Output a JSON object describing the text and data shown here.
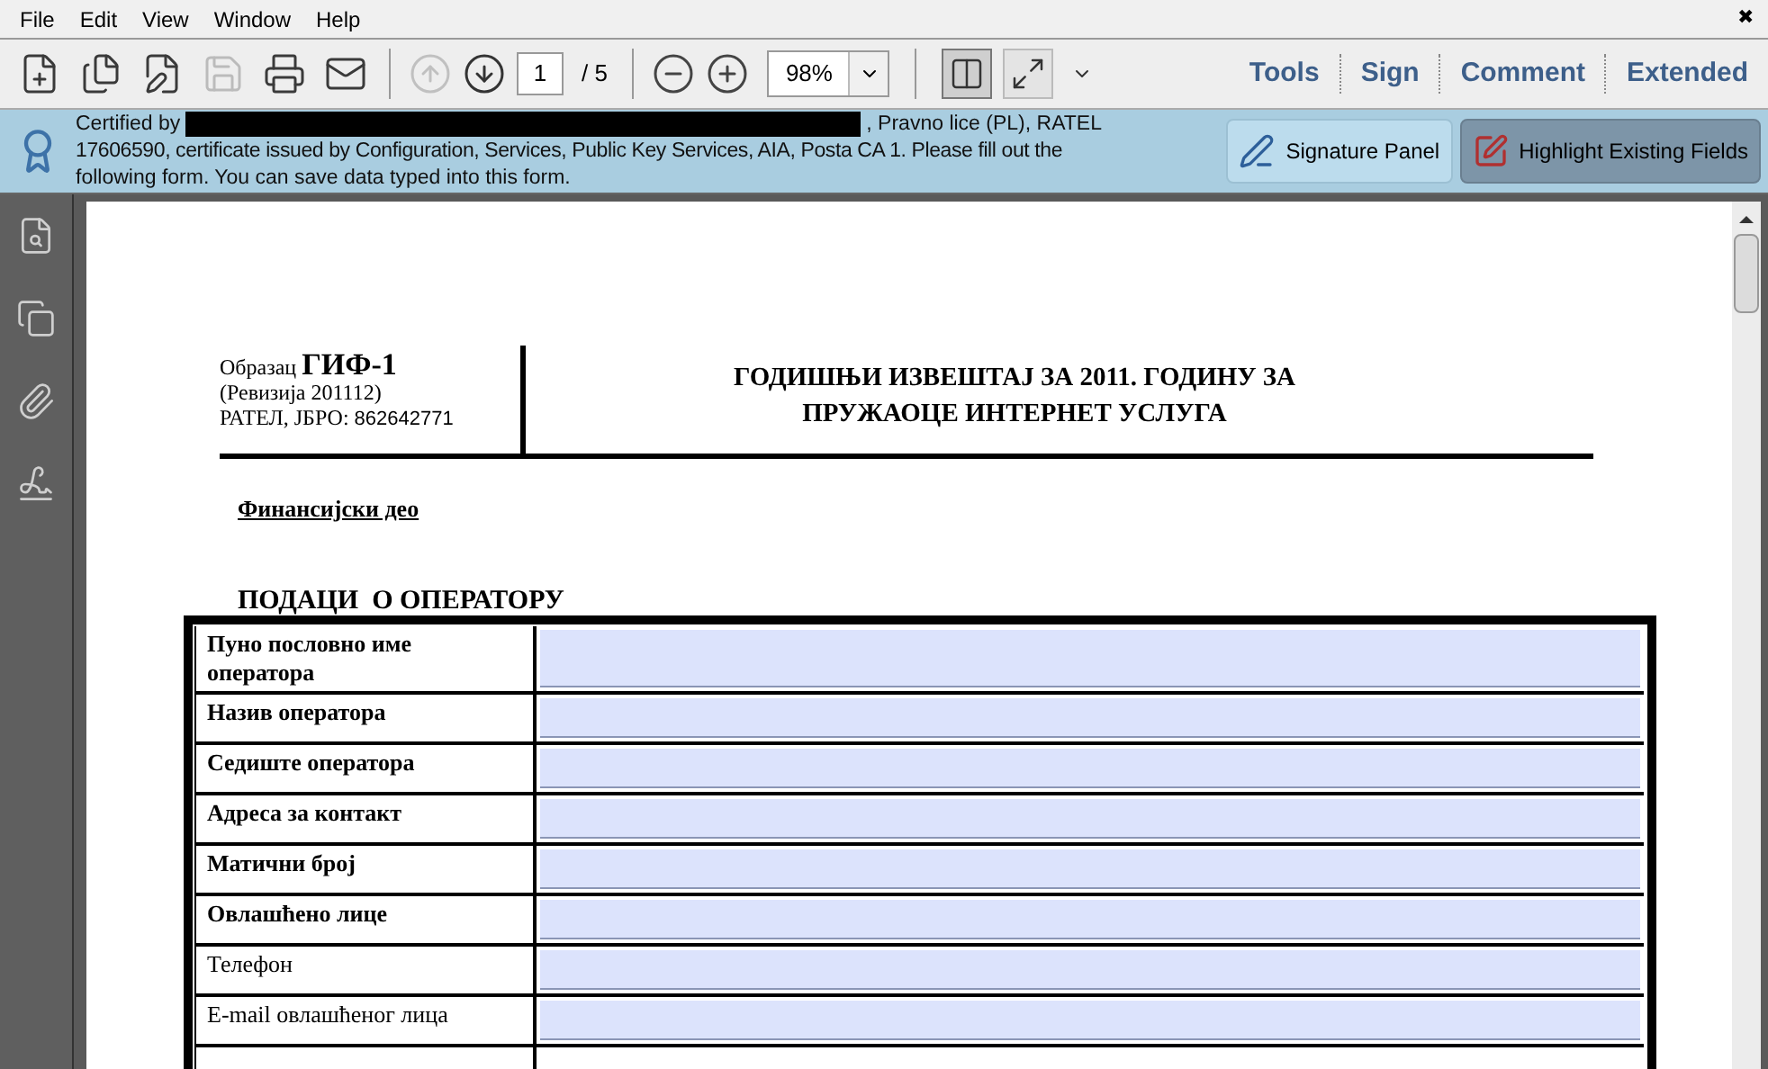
{
  "menu": [
    "File",
    "Edit",
    "View",
    "Window",
    "Help"
  ],
  "close_glyph": "✖",
  "toolbar": {
    "left_icons": [
      {
        "kind": "create",
        "disabled": false
      },
      {
        "kind": "combine",
        "disabled": false
      },
      {
        "kind": "edit",
        "disabled": false
      },
      {
        "kind": "save",
        "disabled": true
      },
      {
        "kind": "print",
        "disabled": false
      },
      {
        "kind": "email",
        "disabled": false
      }
    ],
    "nav_icons": [
      {
        "kind": "prev",
        "disabled": true
      },
      {
        "kind": "next",
        "disabled": false
      }
    ],
    "page_current": "1",
    "page_total": "/ 5",
    "zoom": "98%",
    "view_icons": [
      {
        "kind": "fit-width",
        "pressed": true
      },
      {
        "kind": "fullscreen",
        "pressed": false
      }
    ],
    "task_buttons": [
      "Tools",
      "Sign",
      "Comment",
      "Extended"
    ]
  },
  "notice": {
    "line_1_before": "Certified by",
    "line_1_after": ", Pravno lice (PL), RATEL",
    "line_2": "17606590, certificate issued by Configuration, Services, Public Key Services, AIA, Posta CA 1.  Please fill out the",
    "line_3": "following form. You can save data typed into this form.",
    "buttons": [
      {
        "kind": "signature",
        "label": "Signature Panel",
        "selected": false
      },
      {
        "kind": "highlight",
        "label": "Highlight Existing Fields",
        "selected": true
      }
    ]
  },
  "sidebar_icons": [
    {
      "kind": "pages"
    },
    {
      "kind": "copy"
    },
    {
      "kind": "attachment"
    },
    {
      "kind": "signature"
    }
  ],
  "document": {
    "form_label": "Образац",
    "form_code": "ГИФ-1",
    "revision": "(Ревизија 201112)",
    "ratel_label": "РАТЕЛ, ЈБРО:",
    "ratel_number": "862642771",
    "title_line_1": "ГОДИШЊИ ИЗВЕШТАЈ ЗА 2011. ГОДИНУ ЗА",
    "title_line_2": "ПРУЖАОЦЕ ИНТЕРНЕТ УСЛУГА",
    "section": "Финансијски део",
    "table_heading": "ПОДАЦИ  О ОПЕРАТОРУ",
    "rows": [
      {
        "label": "Пуно пословно име оператора",
        "bold": true
      },
      {
        "label": "Назив оператора",
        "bold": true
      },
      {
        "label": "Седиште оператора",
        "bold": true
      },
      {
        "label": "Адреса за контакт",
        "bold": true
      },
      {
        "label": "Матични број",
        "bold": true
      },
      {
        "label": "Овлашћено лице",
        "bold": true
      },
      {
        "label": "Телефон",
        "bold": false
      },
      {
        "label": "E-mail овлашћеног лица",
        "bold": false
      }
    ]
  }
}
